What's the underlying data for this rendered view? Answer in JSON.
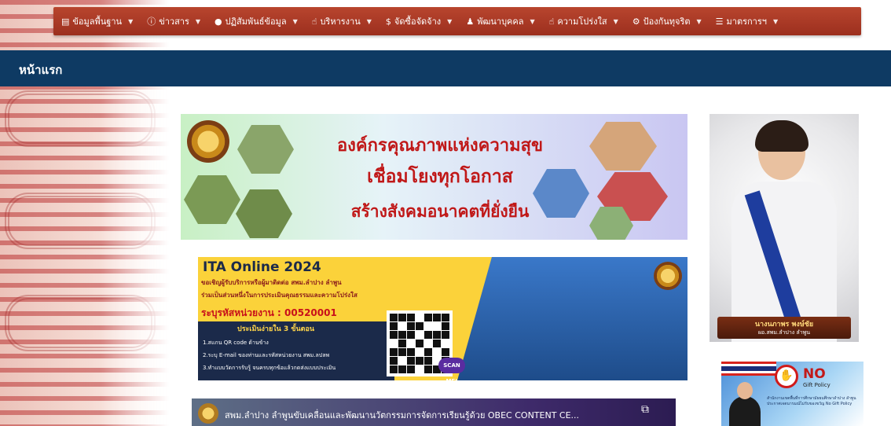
{
  "menu": [
    {
      "icon": "document-icon",
      "glyph": "▤",
      "label": "ข้อมูลพื้นฐาน"
    },
    {
      "icon": "info-icon",
      "glyph": "ⓘ",
      "label": "ข่าวสาร"
    },
    {
      "icon": "globe-icon",
      "glyph": "●",
      "label": "ปฏิสัมพันธ์ข้อมูล"
    },
    {
      "icon": "thumbs-up-icon",
      "glyph": "☝",
      "label": "บริหารงาน"
    },
    {
      "icon": "dollar-icon",
      "glyph": "$",
      "label": "จัดซื้อจัดจ้าง"
    },
    {
      "icon": "person-icon",
      "glyph": "♟",
      "label": "พัฒนาบุคคล"
    },
    {
      "icon": "thumbs-up-icon",
      "glyph": "☝",
      "label": "ความโปร่งใส"
    },
    {
      "icon": "gear-icon",
      "glyph": "⚙",
      "label": "ป้องกันทุจริต"
    },
    {
      "icon": "list-icon",
      "glyph": "☰",
      "label": "มาตรการฯ"
    }
  ],
  "page_title": "หน้าแรก",
  "banner1": {
    "line1": "องค์กรคุณภาพแห่งความสุข",
    "line2": "เชื่อมโยงทุกโอกาส",
    "line3": "สร้างสังคมอนาคตที่ยั่งยืน"
  },
  "banner2": {
    "title": "ITA Online 2024",
    "sub1": "ขอเชิญผู้รับบริการหรือผู้มาติดต่อ สพม.ลำปาง ลำพูน",
    "sub2": "ร่วมเป็นส่วนหนึ่งในการประเมินคุณธรรมและความโปร่งใส",
    "code": "ระบุรหัสหน่วยงาน : 00520001",
    "steps_title": "ประเมินง่ายใน 3 ขั้นตอน",
    "step1": "1.สแกน QR code ด้านข้าง",
    "step2": "2.ระบุ E-mail ของท่านและรหัสหน่วยงาน สพม.ลปลพ",
    "step3": "3.ทำแบบวัดการรับรู้ จนครบทุกข้อแล้วกดส่งแบบประเมิน",
    "scan_badge": "SCAN ME!"
  },
  "video": {
    "title": "สพม.ลำปาง ลำพูนขับเคลื่อนและพัฒนานวัตกรรมการจัดการเรียนรู้ด้วย OBEC CONTENT CE..."
  },
  "portrait": {
    "name": "นางนภาพร พงษ์ชัย",
    "role": "ผอ.สพม.ลำปาง ลำพูน"
  },
  "policy": {
    "no_label": "NO",
    "gift_label": "Gift Policy",
    "text": "สำนักงานเขตพื้นที่การศึกษามัธยมศึกษาลำปาง ลำพูน ประกาศเจตนารมณ์ไม่รับของขวัญ No Gift Policy"
  },
  "colors": {
    "menu_bg": "#a8361f",
    "title_bar": "#0e3a63",
    "banner_text": "#c01818"
  }
}
